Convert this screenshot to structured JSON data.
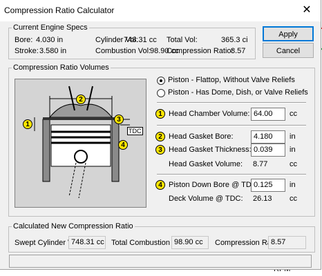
{
  "dialog": {
    "title": "Compression Ratio Calculator",
    "close_glyph": "✕"
  },
  "current_specs": {
    "legend": "Current Engine Specs",
    "bore_label": "Bore:",
    "bore_value": "4.030 in",
    "stroke_label": "Stroke:",
    "stroke_value": "3.580 in",
    "cyl_vol_label": "Cylinder Vol:",
    "cyl_vol_value": "748.31 cc",
    "comb_vol_label": "Combustion Vol:",
    "comb_vol_value": "98.90 cc",
    "total_vol_label": "Total Vol:",
    "total_vol_value": "365.3 ci",
    "cr_label": "Compression Ratio:",
    "cr_value": "8.57"
  },
  "buttons": {
    "apply": "Apply",
    "cancel": "Cancel"
  },
  "volumes": {
    "legend": "Compression Ratio Volumes",
    "radio_flattop": "Piston - Flattop, Without Valve Reliefs",
    "radio_dome": "Piston - Has Dome, Dish, or Valve Reliefs",
    "head_chamber_label": "Head Chamber Volume:",
    "head_chamber_value": "64.00",
    "head_chamber_unit": "cc",
    "gasket_bore_label": "Head Gasket Bore:",
    "gasket_bore_value": "4.180",
    "gasket_bore_unit": "in",
    "gasket_thick_label": "Head Gasket Thickness:",
    "gasket_thick_value": "0.039",
    "gasket_thick_unit": "in",
    "gasket_vol_label": "Head Gasket Volume:",
    "gasket_vol_value": "8.77",
    "gasket_vol_unit": "cc",
    "piston_down_label": "Piston Down Bore @ TDC:",
    "piston_down_value": "0.125",
    "piston_down_unit": "in",
    "deck_vol_label": "Deck Volume @ TDC:",
    "deck_vol_value": "26.13",
    "deck_vol_unit": "cc",
    "badges": [
      "1",
      "2",
      "3",
      "4"
    ],
    "tdc_label": "TDC"
  },
  "calculated": {
    "legend": "Calculated New Compression Ratio",
    "swept_label": "Swept Cylinder Vol:",
    "swept_value": "748.31 cc",
    "total_comb_label": "Total Combustion Vol:",
    "total_comb_value": "98.90 cc",
    "cr_label": "Compression Ratio:",
    "cr_value": "8.57"
  },
  "background": {
    "rpm_label": "RPM"
  },
  "colors": {
    "badge": "#ffe600",
    "focus_border": "#0078d7"
  }
}
